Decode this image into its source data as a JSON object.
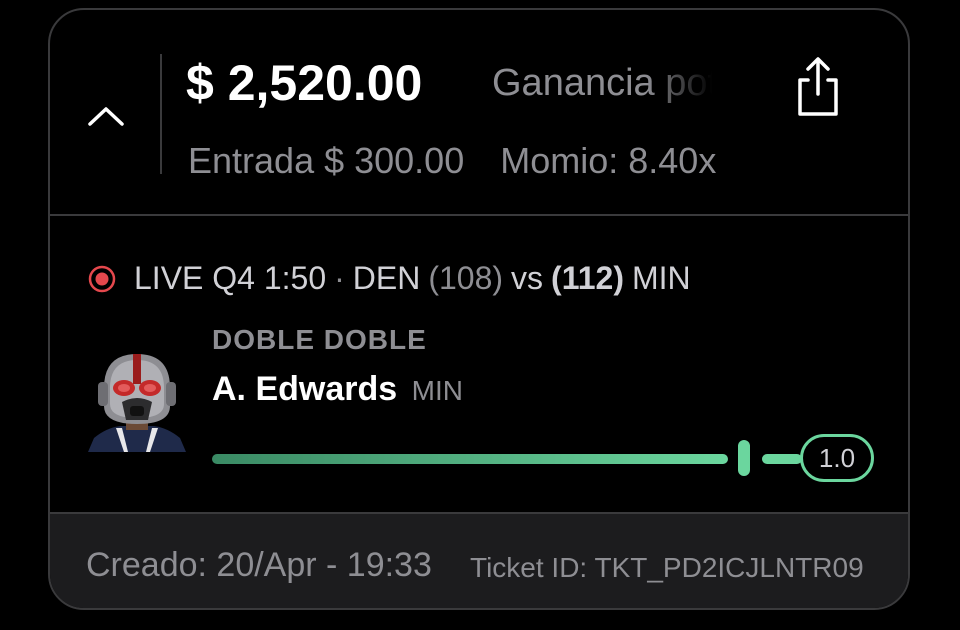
{
  "header": {
    "payout": "$ 2,520.00",
    "payout_label": "Ganancia potencial",
    "stake": "Entrada $ 300.00",
    "odds": "Momio: 8.40x",
    "collapse_icon": "chevron-up-icon",
    "share_icon": "share-icon"
  },
  "game": {
    "status_icon": "live-record-icon",
    "live_label": "LIVE Q4 1:50",
    "separator": "·",
    "away_team": "DEN",
    "away_score": "(108)",
    "vs": "vs",
    "home_score": "(112)",
    "home_team": "MIN"
  },
  "pick": {
    "market": "DOBLE DOBLE",
    "player_name": "A. Edwards",
    "player_team": "MIN",
    "progress": 1.0,
    "target": "1.0"
  },
  "footer": {
    "created": "Creado: 20/Apr - 19:33",
    "ticket_id": "Ticket ID: TKT_PD2ICJLNTR09"
  },
  "colors": {
    "accent_green": "#6bd69e",
    "live_red": "#e5484d",
    "muted_text": "#8e8e93",
    "border": "#3a3a3c"
  }
}
